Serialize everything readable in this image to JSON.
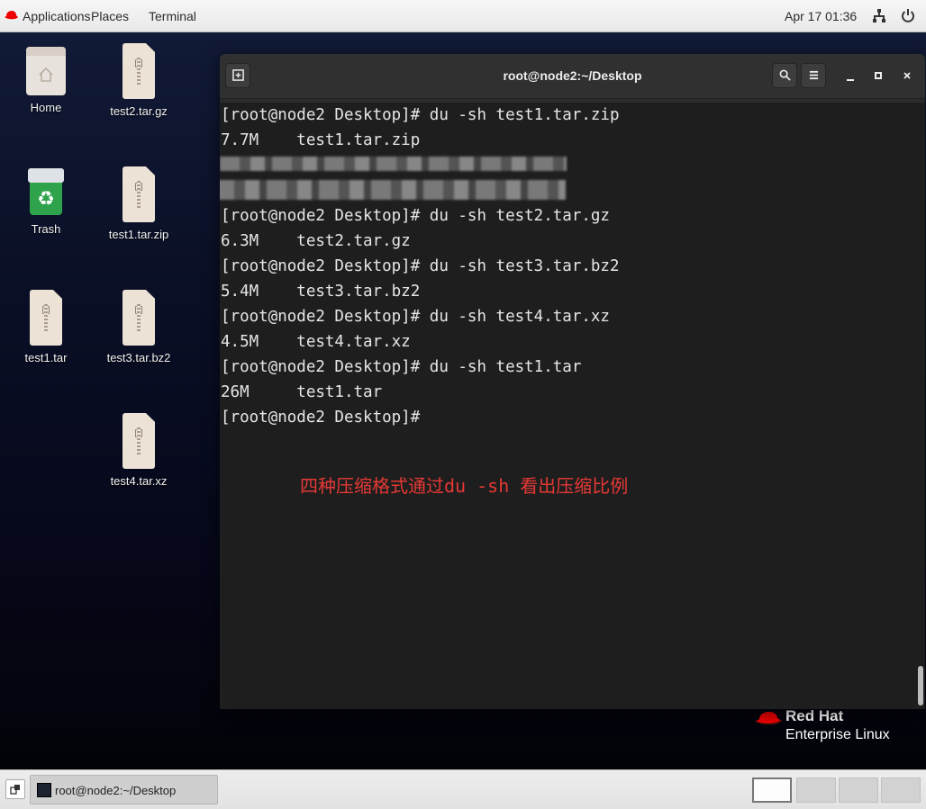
{
  "topbar": {
    "applications": "Applications",
    "places": "Places",
    "terminal": "Terminal",
    "clock": "Apr 17  01:36",
    "network_icon": "network-icon",
    "power_icon": "power-icon"
  },
  "desktop": {
    "icons": [
      {
        "label": "Home",
        "type": "home-folder"
      },
      {
        "label": "test2.tar.gz",
        "type": "archive"
      },
      {
        "label": "Trash",
        "type": "trash"
      },
      {
        "label": "test1.tar.zip",
        "type": "archive"
      },
      {
        "label": "test1.tar",
        "type": "archive"
      },
      {
        "label": "test3.tar.bz2",
        "type": "archive"
      },
      {
        "label": "test4.tar.xz",
        "type": "archive"
      }
    ],
    "brand": {
      "line1": "Red Hat",
      "line2": "Enterprise Linux"
    }
  },
  "terminal": {
    "title": "root@node2:~/Desktop",
    "lines": [
      "[root@node2 Desktop]# du -sh test1.tar.zip",
      "7.7M    test1.tar.zip",
      "[root@node2 Desktop]# du -sh test2.tar.gz",
      "6.3M    test2.tar.gz",
      "[root@node2 Desktop]# du -sh test3.tar.bz2",
      "5.4M    test3.tar.bz2",
      "[root@node2 Desktop]# du -sh test4.tar.xz",
      "4.5M    test4.tar.xz",
      "[root@node2 Desktop]# du -sh test1.tar",
      "26M     test1.tar",
      "[root@node2 Desktop]#"
    ],
    "annotation": "四种压缩格式通过du -sh 看出压缩比例"
  },
  "taskbar": {
    "task_label": "root@node2:~/Desktop",
    "workspaces": [
      true,
      false,
      false,
      false
    ]
  }
}
